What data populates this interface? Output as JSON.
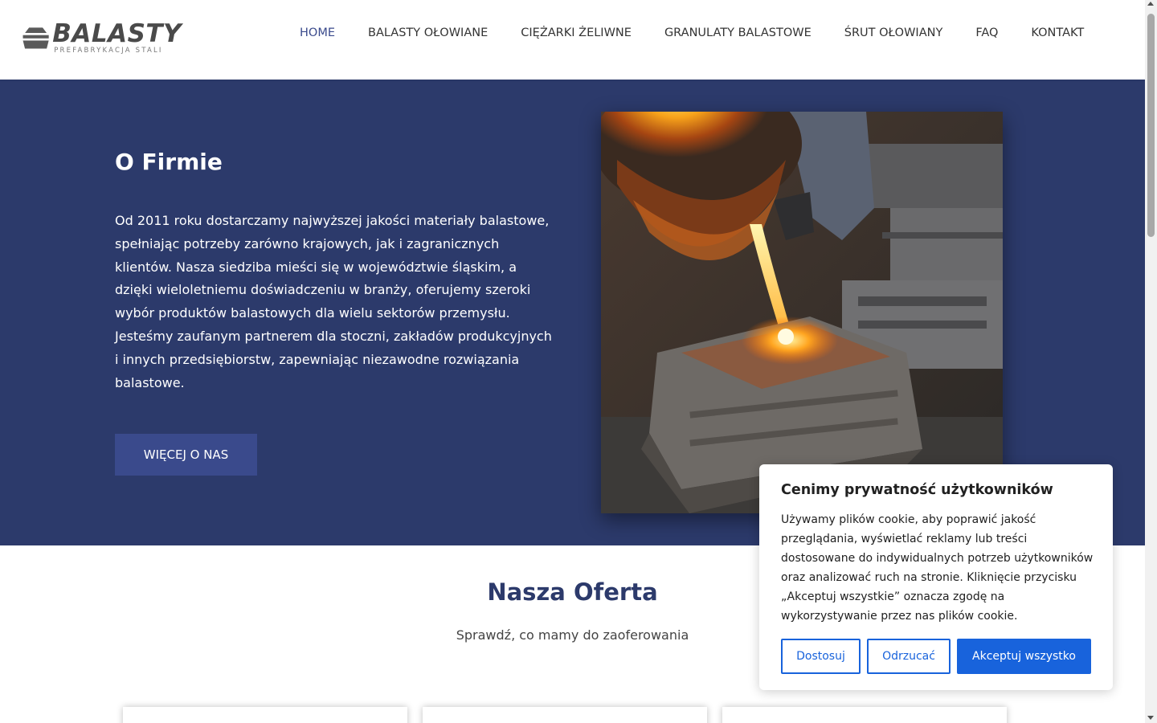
{
  "logo": {
    "main": "BALASTY",
    "sub": "PREFABRYKACJA STALI"
  },
  "nav": {
    "items": [
      {
        "label": "HOME"
      },
      {
        "label": "BALASTY OŁOWIANE"
      },
      {
        "label": "CIĘŻARKI ŻELIWNE"
      },
      {
        "label": "GRANULATY BALASTOWE"
      },
      {
        "label": "ŚRUT OŁOWIANY"
      },
      {
        "label": "FAQ"
      },
      {
        "label": "KONTAKT"
      }
    ],
    "active": "HOME"
  },
  "hero": {
    "title": "O Firmie",
    "text": "Od 2011 roku dostarczamy najwyższej jakości materiały balastowe, spełniając potrzeby zarówno krajowych, jak i zagranicznych klientów. Nasza siedziba mieści się w województwie śląskim, a dzięki wieloletniemu doświadczeniu w branży, oferujemy szeroki wybór produktów balastowych dla wielu sektorów przemysłu. Jesteśmy zaufanym partnerem dla stoczni, zakładów produkcyjnych i innych przedsiębiorstw, zapewniając niezawodne rozwiązania balastowe.",
    "button": "WIĘCEJ O NAS",
    "image_icon": "foundry-pouring-image"
  },
  "offer": {
    "title": "Nasza Oferta",
    "subtitle": "Sprawdź, co mamy do zaoferowania"
  },
  "cookie": {
    "title": "Cenimy prywatność użytkowników",
    "text": "Używamy plików cookie, aby poprawić jakość przeglądania, wyświetlać reklamy lub treści dostosowane do indywidualnych potrzeb użytkowników oraz analizować ruch na stronie. Kliknięcie przycisku „Akceptuj wszystkie” oznacza zgodę na wykorzystywanie przez nas plików cookie.",
    "customize": "Dostosuj",
    "reject": "Odrzucać",
    "accept": "Akceptuj wszystko"
  },
  "colors": {
    "hero_bg": "#2c3a6b",
    "accent": "#3a4a8c",
    "cookie_accent": "#1863dc"
  }
}
